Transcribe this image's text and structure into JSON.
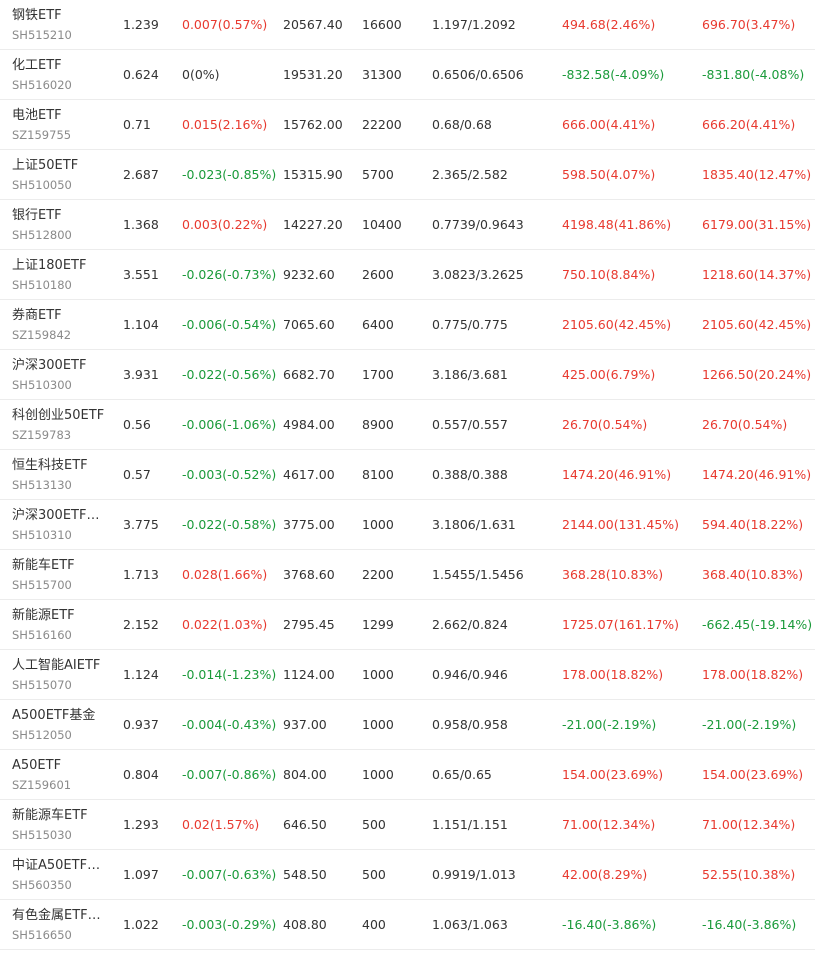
{
  "colors": {
    "up": "#e8392f",
    "down": "#1a9a3a",
    "neutral": "#333333"
  },
  "rows": [
    {
      "name": "钢铁ETF",
      "code": "SH515210",
      "price": "1.239",
      "change": "0.007(0.57%)",
      "change_dir": "up",
      "market_value": "20567.40",
      "quantity": "16600",
      "cost": "1.197/1.2092",
      "pl1": "494.68(2.46%)",
      "pl1_dir": "up",
      "pl2": "696.70(3.47%)",
      "pl2_dir": "up"
    },
    {
      "name": "化工ETF",
      "code": "SH516020",
      "price": "0.624",
      "change": "0(0%)",
      "change_dir": "neutral",
      "market_value": "19531.20",
      "quantity": "31300",
      "cost": "0.6506/0.6506",
      "pl1": "-832.58(-4.09%)",
      "pl1_dir": "down",
      "pl2": "-831.80(-4.08%)",
      "pl2_dir": "down"
    },
    {
      "name": "电池ETF",
      "code": "SZ159755",
      "price": "0.71",
      "change": "0.015(2.16%)",
      "change_dir": "up",
      "market_value": "15762.00",
      "quantity": "22200",
      "cost": "0.68/0.68",
      "pl1": "666.00(4.41%)",
      "pl1_dir": "up",
      "pl2": "666.20(4.41%)",
      "pl2_dir": "up"
    },
    {
      "name": "上证50ETF",
      "code": "SH510050",
      "price": "2.687",
      "change": "-0.023(-0.85%)",
      "change_dir": "down",
      "market_value": "15315.90",
      "quantity": "5700",
      "cost": "2.365/2.582",
      "pl1": "598.50(4.07%)",
      "pl1_dir": "up",
      "pl2": "1835.40(12.47%)",
      "pl2_dir": "up"
    },
    {
      "name": "银行ETF",
      "code": "SH512800",
      "price": "1.368",
      "change": "0.003(0.22%)",
      "change_dir": "up",
      "market_value": "14227.20",
      "quantity": "10400",
      "cost": "0.7739/0.9643",
      "pl1": "4198.48(41.86%)",
      "pl1_dir": "up",
      "pl2": "6179.00(31.15%)",
      "pl2_dir": "up"
    },
    {
      "name": "上证180ETF",
      "code": "SH510180",
      "price": "3.551",
      "change": "-0.026(-0.73%)",
      "change_dir": "down",
      "market_value": "9232.60",
      "quantity": "2600",
      "cost": "3.0823/3.2625",
      "pl1": "750.10(8.84%)",
      "pl1_dir": "up",
      "pl2": "1218.60(14.37%)",
      "pl2_dir": "up"
    },
    {
      "name": "券商ETF",
      "code": "SZ159842",
      "price": "1.104",
      "change": "-0.006(-0.54%)",
      "change_dir": "down",
      "market_value": "7065.60",
      "quantity": "6400",
      "cost": "0.775/0.775",
      "pl1": "2105.60(42.45%)",
      "pl1_dir": "up",
      "pl2": "2105.60(42.45%)",
      "pl2_dir": "up"
    },
    {
      "name": "沪深300ETF",
      "code": "SH510300",
      "price": "3.931",
      "change": "-0.022(-0.56%)",
      "change_dir": "down",
      "market_value": "6682.70",
      "quantity": "1700",
      "cost": "3.186/3.681",
      "pl1": "425.00(6.79%)",
      "pl1_dir": "up",
      "pl2": "1266.50(20.24%)",
      "pl2_dir": "up"
    },
    {
      "name": "科创创业50ETF",
      "code": "SZ159783",
      "price": "0.56",
      "change": "-0.006(-1.06%)",
      "change_dir": "down",
      "market_value": "4984.00",
      "quantity": "8900",
      "cost": "0.557/0.557",
      "pl1": "26.70(0.54%)",
      "pl1_dir": "up",
      "pl2": "26.70(0.54%)",
      "pl2_dir": "up"
    },
    {
      "name": "恒生科技ETF",
      "code": "SH513130",
      "price": "0.57",
      "change": "-0.003(-0.52%)",
      "change_dir": "down",
      "market_value": "4617.00",
      "quantity": "8100",
      "cost": "0.388/0.388",
      "pl1": "1474.20(46.91%)",
      "pl1_dir": "up",
      "pl2": "1474.20(46.91%)",
      "pl2_dir": "up"
    },
    {
      "name": "沪深300ETF…",
      "code": "SH510310",
      "price": "3.775",
      "change": "-0.022(-0.58%)",
      "change_dir": "down",
      "market_value": "3775.00",
      "quantity": "1000",
      "cost": "3.1806/1.631",
      "pl1": "2144.00(131.45%)",
      "pl1_dir": "up",
      "pl2": "594.40(18.22%)",
      "pl2_dir": "up"
    },
    {
      "name": "新能车ETF",
      "code": "SH515700",
      "price": "1.713",
      "change": "0.028(1.66%)",
      "change_dir": "up",
      "market_value": "3768.60",
      "quantity": "2200",
      "cost": "1.5455/1.5456",
      "pl1": "368.28(10.83%)",
      "pl1_dir": "up",
      "pl2": "368.40(10.83%)",
      "pl2_dir": "up"
    },
    {
      "name": "新能源ETF",
      "code": "SH516160",
      "price": "2.152",
      "change": "0.022(1.03%)",
      "change_dir": "up",
      "market_value": "2795.45",
      "quantity": "1299",
      "cost": "2.662/0.824",
      "pl1": "1725.07(161.17%)",
      "pl1_dir": "up",
      "pl2": "-662.45(-19.14%)",
      "pl2_dir": "down"
    },
    {
      "name": "人工智能AIETF",
      "code": "SH515070",
      "price": "1.124",
      "change": "-0.014(-1.23%)",
      "change_dir": "down",
      "market_value": "1124.00",
      "quantity": "1000",
      "cost": "0.946/0.946",
      "pl1": "178.00(18.82%)",
      "pl1_dir": "up",
      "pl2": "178.00(18.82%)",
      "pl2_dir": "up"
    },
    {
      "name": "A500ETF基金",
      "code": "SH512050",
      "price": "0.937",
      "change": "-0.004(-0.43%)",
      "change_dir": "down",
      "market_value": "937.00",
      "quantity": "1000",
      "cost": "0.958/0.958",
      "pl1": "-21.00(-2.19%)",
      "pl1_dir": "down",
      "pl2": "-21.00(-2.19%)",
      "pl2_dir": "down"
    },
    {
      "name": "A50ETF",
      "code": "SZ159601",
      "price": "0.804",
      "change": "-0.007(-0.86%)",
      "change_dir": "down",
      "market_value": "804.00",
      "quantity": "1000",
      "cost": "0.65/0.65",
      "pl1": "154.00(23.69%)",
      "pl1_dir": "up",
      "pl2": "154.00(23.69%)",
      "pl2_dir": "up"
    },
    {
      "name": "新能源车ETF",
      "code": "SH515030",
      "price": "1.293",
      "change": "0.02(1.57%)",
      "change_dir": "up",
      "market_value": "646.50",
      "quantity": "500",
      "cost": "1.151/1.151",
      "pl1": "71.00(12.34%)",
      "pl1_dir": "up",
      "pl2": "71.00(12.34%)",
      "pl2_dir": "up"
    },
    {
      "name": "中证A50ETF…",
      "code": "SH560350",
      "price": "1.097",
      "change": "-0.007(-0.63%)",
      "change_dir": "down",
      "market_value": "548.50",
      "quantity": "500",
      "cost": "0.9919/1.013",
      "pl1": "42.00(8.29%)",
      "pl1_dir": "up",
      "pl2": "52.55(10.38%)",
      "pl2_dir": "up"
    },
    {
      "name": "有色金属ETF…",
      "code": "SH516650",
      "price": "1.022",
      "change": "-0.003(-0.29%)",
      "change_dir": "down",
      "market_value": "408.80",
      "quantity": "400",
      "cost": "1.063/1.063",
      "pl1": "-16.40(-3.86%)",
      "pl1_dir": "down",
      "pl2": "-16.40(-3.86%)",
      "pl2_dir": "down"
    }
  ]
}
